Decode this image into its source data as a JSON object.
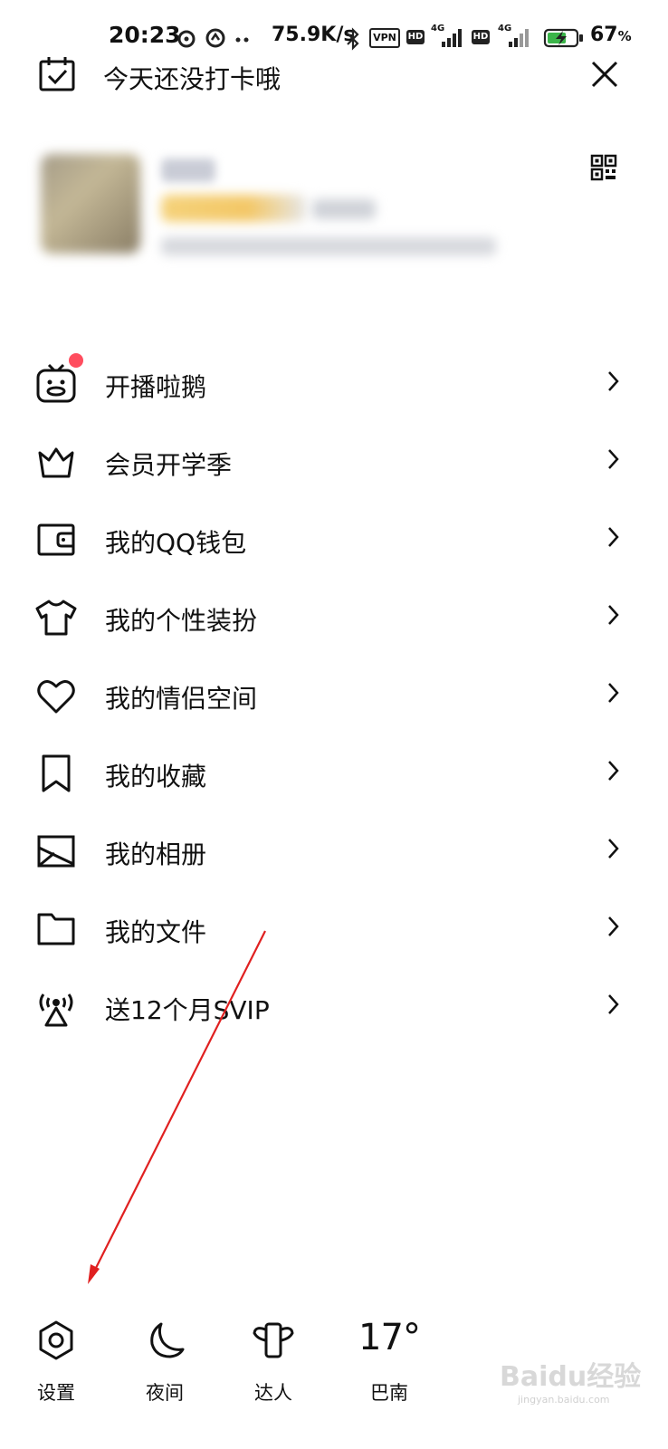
{
  "status_bar": {
    "time": "20:23",
    "net_speed": "75.9K/s",
    "vpn": "VPN",
    "hd": "HD",
    "net1": "4G",
    "net2": "4G",
    "battery": "67",
    "battery_unit": "%",
    "battery_level": 0.67
  },
  "header": {
    "checkin_text": "今天还没打卡哦"
  },
  "menu": [
    {
      "label": "开播啦鹅",
      "icon": "tv-penguin-icon",
      "badge": true
    },
    {
      "label": "会员开学季",
      "icon": "crown-icon"
    },
    {
      "label": "我的QQ钱包",
      "icon": "wallet-icon"
    },
    {
      "label": "我的个性装扮",
      "icon": "tshirt-icon"
    },
    {
      "label": "我的情侣空间",
      "icon": "heart-icon"
    },
    {
      "label": "我的收藏",
      "icon": "bookmark-icon"
    },
    {
      "label": "我的相册",
      "icon": "image-icon"
    },
    {
      "label": "我的文件",
      "icon": "folder-icon"
    },
    {
      "label": "送12个月SVIP",
      "icon": "broadcast-icon"
    }
  ],
  "bottom_bar": {
    "settings": "设置",
    "night": "夜间",
    "expert": "达人",
    "weather_temp": "17°",
    "weather_city": "巴南"
  },
  "watermark": {
    "text": "Baidu经验",
    "sub": "jingyan.baidu.com"
  },
  "colors": {
    "badge": "#ff4d5e",
    "annotation_arrow": "#e02020"
  }
}
